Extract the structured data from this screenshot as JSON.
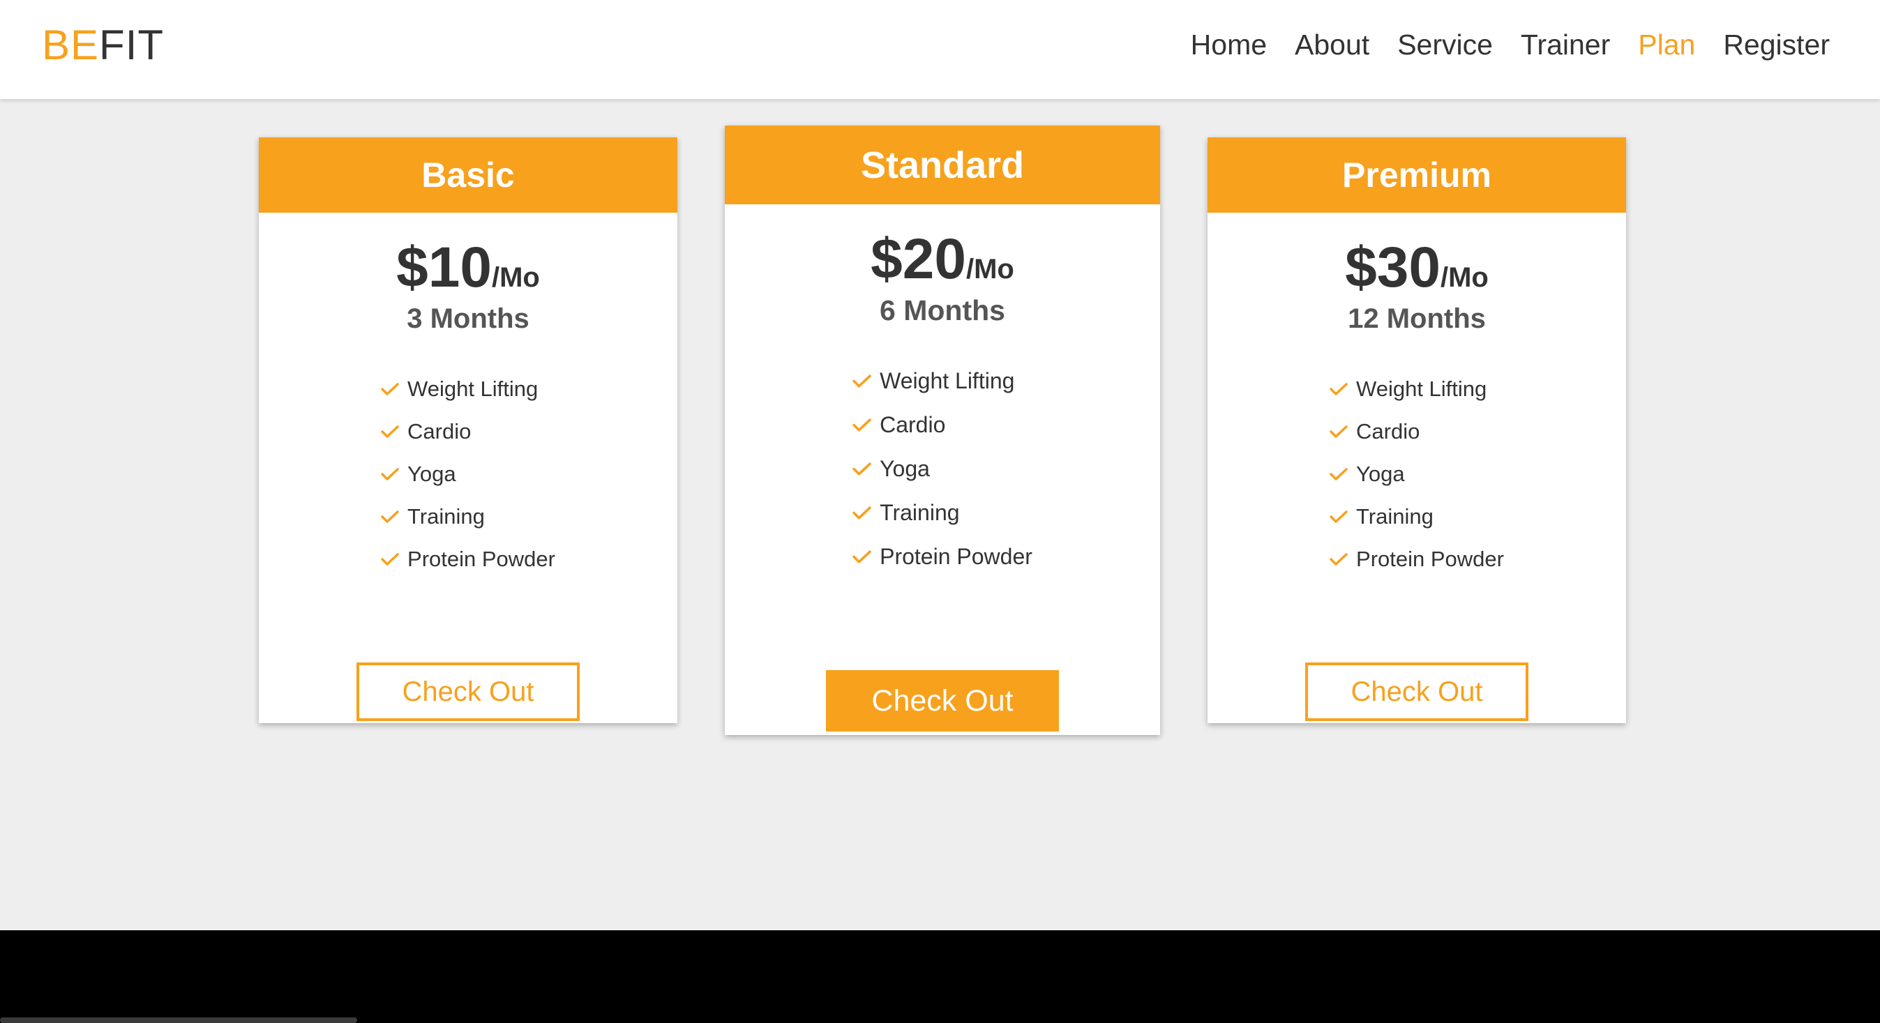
{
  "header": {
    "logo_accent": "BE",
    "logo_rest": "FIT",
    "nav": [
      "Home",
      "About",
      "Service",
      "Trainer",
      "Plan",
      "Register"
    ],
    "active_nav": "Plan"
  },
  "colors": {
    "accent": "#f7a11d",
    "background": "#eeeeee",
    "footer": "#000000"
  },
  "plans": [
    {
      "name": "Basic",
      "price": "$10",
      "per": "/Mo",
      "duration": "3 Months",
      "features": [
        "Weight Lifting",
        "Cardio",
        "Yoga",
        "Training",
        "Protein Powder"
      ],
      "button": "Check Out",
      "featured": false
    },
    {
      "name": "Standard",
      "price": "$20",
      "per": "/Mo",
      "duration": "6 Months",
      "features": [
        "Weight Lifting",
        "Cardio",
        "Yoga",
        "Training",
        "Protein Powder"
      ],
      "button": "Check Out",
      "featured": true
    },
    {
      "name": "Premium",
      "price": "$30",
      "per": "/Mo",
      "duration": "12 Months",
      "features": [
        "Weight Lifting",
        "Cardio",
        "Yoga",
        "Training",
        "Protein Powder"
      ],
      "button": "Check Out",
      "featured": false
    }
  ],
  "icons": {
    "feature": "check-icon"
  }
}
